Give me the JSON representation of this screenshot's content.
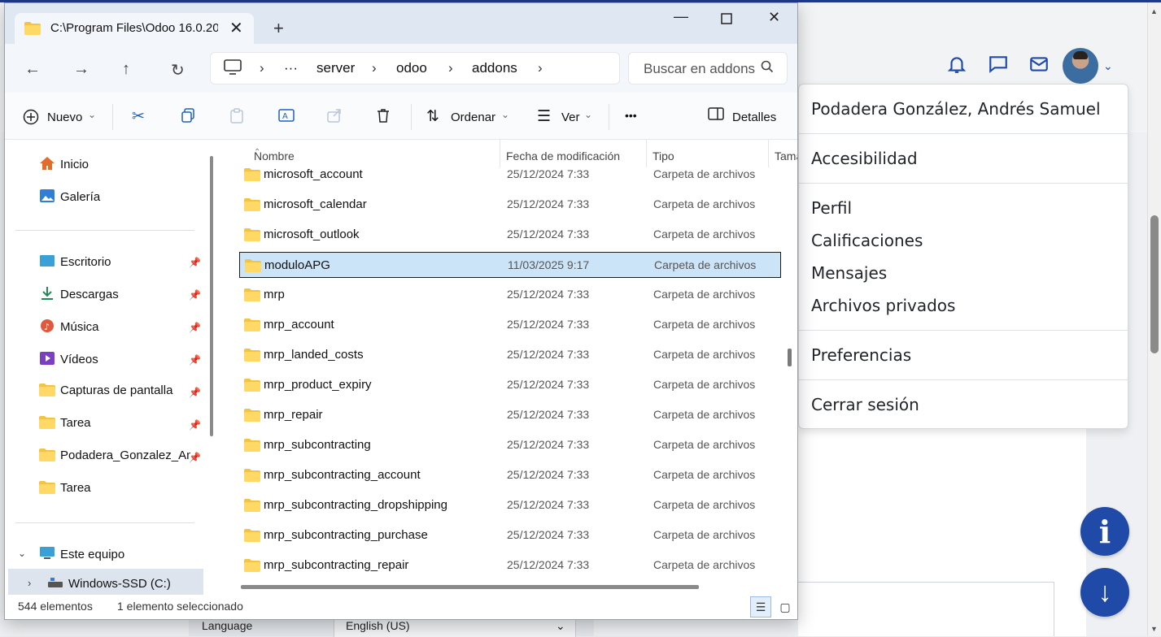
{
  "odoo": {
    "user_menu": {
      "user_name": "Podadera González, Andrés Samuel",
      "accessibility": "Accesibilidad",
      "profile": "Perfil",
      "ratings": "Calificaciones",
      "messages": "Mensajes",
      "private_files": "Archivos privados",
      "preferences": "Preferencias",
      "logout": "Cerrar sesión"
    },
    "language_row": {
      "label": "Language",
      "value": "English (US)"
    },
    "fab_info": "i",
    "fab_down": "↓"
  },
  "explorer": {
    "tab_title": "C:\\Program Files\\Odoo 16.0.20",
    "address": {
      "ellipsis": "···",
      "segments": [
        "server",
        "odoo",
        "addons"
      ]
    },
    "search_placeholder": "Buscar en addons",
    "toolbar": {
      "new": "Nuevo",
      "sort": "Ordenar",
      "view": "Ver",
      "more": "•••",
      "details": "Detalles"
    },
    "sidebar": {
      "home": "Inicio",
      "gallery": "Galería",
      "pinned": [
        "Escritorio",
        "Descargas",
        "Música",
        "Vídeos",
        "Capturas de pantalla",
        "Tarea",
        "Podadera_Gonzalez_Andres",
        "Tarea"
      ],
      "this_pc": "Este equipo",
      "drive": "Windows-SSD (C:)"
    },
    "columns": {
      "name": "Nombre",
      "modified": "Fecha de modificación",
      "type": "Tipo",
      "size": "Tamaño"
    },
    "files": [
      {
        "name": "microsoft_account",
        "date": "25/12/2024 7:33",
        "type": "Carpeta de archivos"
      },
      {
        "name": "microsoft_calendar",
        "date": "25/12/2024 7:33",
        "type": "Carpeta de archivos"
      },
      {
        "name": "microsoft_outlook",
        "date": "25/12/2024 7:33",
        "type": "Carpeta de archivos"
      },
      {
        "name": "moduloAPG",
        "date": "11/03/2025 9:17",
        "type": "Carpeta de archivos",
        "selected": true
      },
      {
        "name": "mrp",
        "date": "25/12/2024 7:33",
        "type": "Carpeta de archivos"
      },
      {
        "name": "mrp_account",
        "date": "25/12/2024 7:33",
        "type": "Carpeta de archivos"
      },
      {
        "name": "mrp_landed_costs",
        "date": "25/12/2024 7:33",
        "type": "Carpeta de archivos"
      },
      {
        "name": "mrp_product_expiry",
        "date": "25/12/2024 7:33",
        "type": "Carpeta de archivos"
      },
      {
        "name": "mrp_repair",
        "date": "25/12/2024 7:33",
        "type": "Carpeta de archivos"
      },
      {
        "name": "mrp_subcontracting",
        "date": "25/12/2024 7:33",
        "type": "Carpeta de archivos"
      },
      {
        "name": "mrp_subcontracting_account",
        "date": "25/12/2024 7:33",
        "type": "Carpeta de archivos"
      },
      {
        "name": "mrp_subcontracting_dropshipping",
        "date": "25/12/2024 7:33",
        "type": "Carpeta de archivos"
      },
      {
        "name": "mrp_subcontracting_purchase",
        "date": "25/12/2024 7:33",
        "type": "Carpeta de archivos"
      },
      {
        "name": "mrp_subcontracting_repair",
        "date": "25/12/2024 7:33",
        "type": "Carpeta de archivos"
      }
    ],
    "status": {
      "count": "544 elementos",
      "selected": "1 elemento seleccionado"
    }
  },
  "colors": {
    "odoo_accent": "#1f4aa8",
    "selection": "#cce4f7",
    "folder": "#f3c442"
  }
}
